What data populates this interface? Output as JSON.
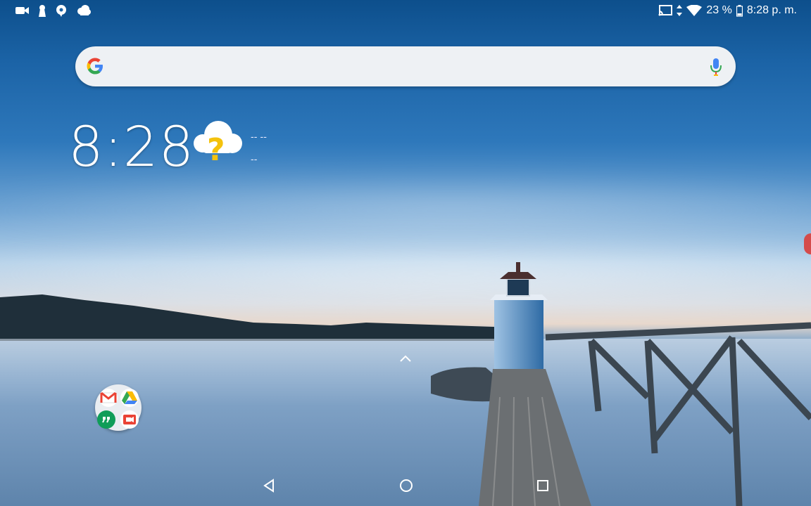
{
  "status_bar": {
    "left_icons": [
      "video-camera-icon",
      "keyhole-icon",
      "chat-bubble-icon",
      "cloud-icon"
    ],
    "right_icons": [
      "cast-icon",
      "data-arrows-icon",
      "wifi-icon"
    ],
    "battery_percent": "23 %",
    "time": "8:28 p. m."
  },
  "search_bar": {
    "logo": "google-g-icon",
    "mic": "microphone-icon",
    "placeholder": ""
  },
  "clock_widget": {
    "time": "8:28",
    "weather_icon": "cloud-question-icon",
    "line1": "-- --",
    "line2": "--"
  },
  "app_drawer": {
    "icon": "chevron-up-icon"
  },
  "folder": {
    "apps": [
      {
        "name": "Gmail",
        "icon": "gmail-icon",
        "color": "#ea4335"
      },
      {
        "name": "Drive",
        "icon": "drive-icon",
        "color": "#34a853"
      },
      {
        "name": "Hangouts",
        "icon": "hangouts-icon",
        "color": "#0f9d58"
      },
      {
        "name": "Meet",
        "icon": "meet-icon",
        "color": "#ea4335"
      }
    ]
  },
  "nav_bar": {
    "back": "back-triangle-icon",
    "home": "home-circle-icon",
    "recents": "recents-square-icon"
  },
  "colors": {
    "accent_blue": "#1b63a6",
    "google_blue": "#4285f4",
    "google_red": "#ea4335",
    "google_yellow": "#fbbc05",
    "google_green": "#34a853"
  }
}
